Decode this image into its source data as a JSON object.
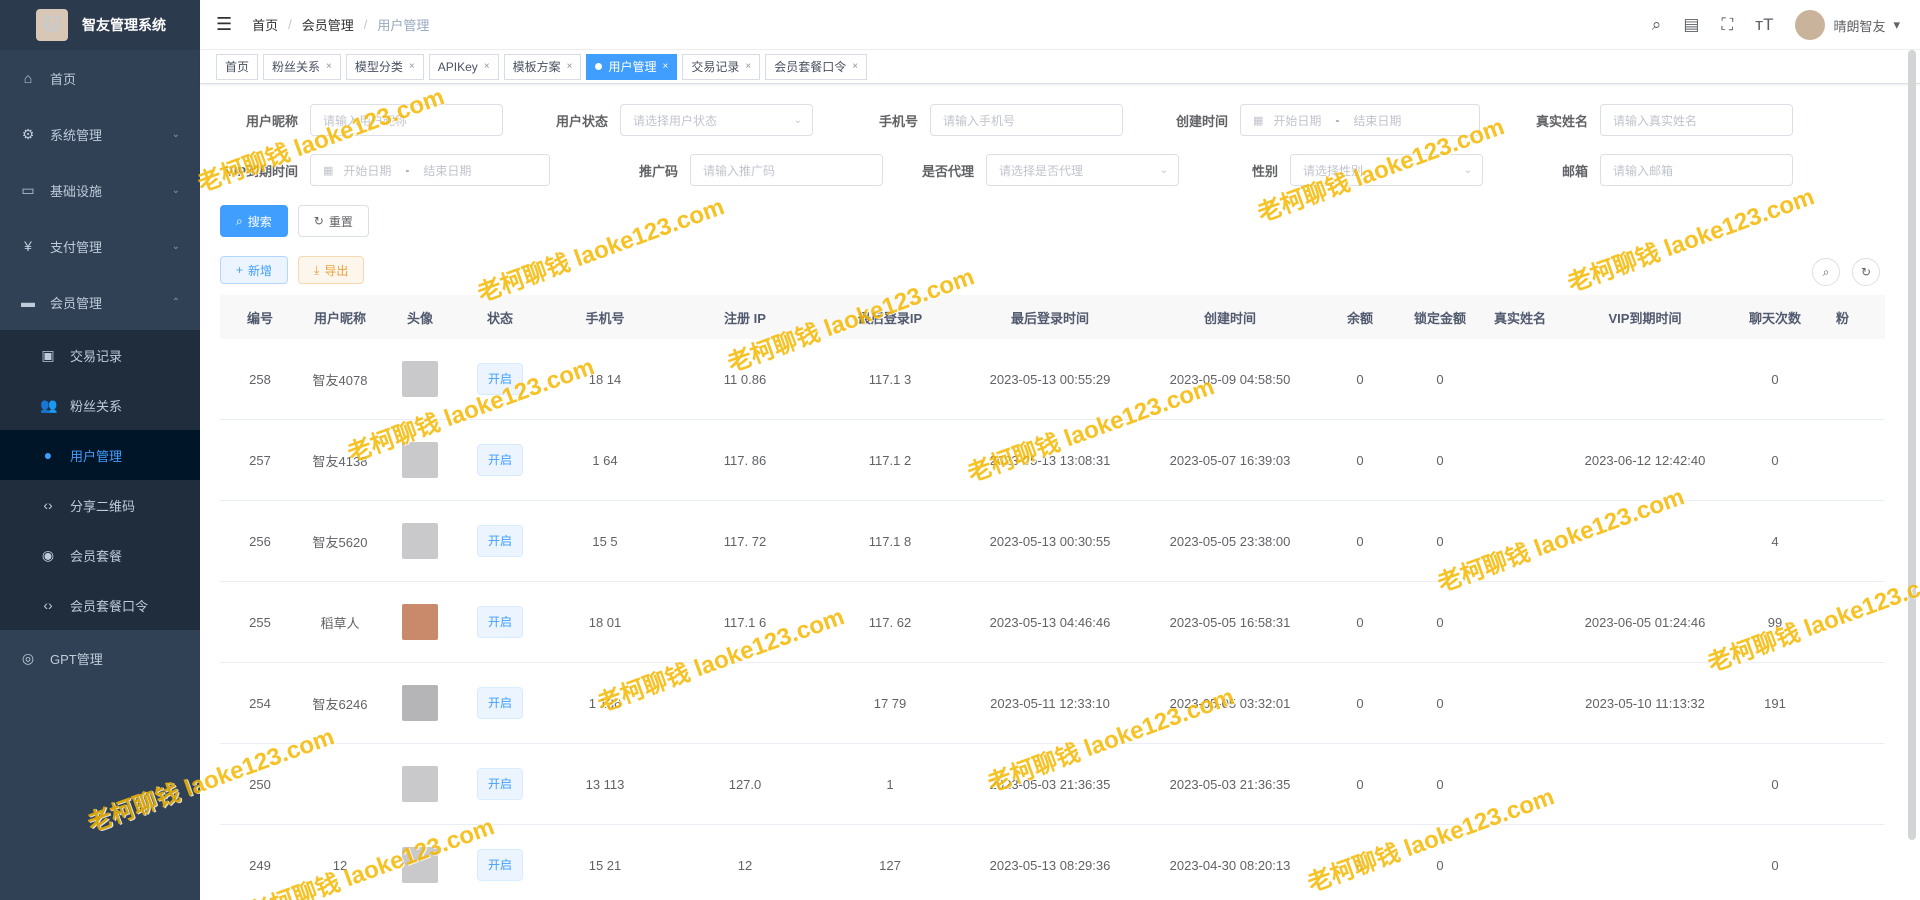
{
  "app": {
    "title": "智友管理系统"
  },
  "sidebar": {
    "items": [
      {
        "label": "首页",
        "icon": "dashboard-icon"
      },
      {
        "label": "系统管理",
        "icon": "gear-icon"
      },
      {
        "label": "基础设施",
        "icon": "monitor-icon"
      },
      {
        "label": "支付管理",
        "icon": "yen-icon"
      },
      {
        "label": "会员管理",
        "icon": "member-icon"
      }
    ],
    "subitems": [
      {
        "label": "交易记录",
        "icon": "record-icon"
      },
      {
        "label": "粉丝关系",
        "icon": "fans-icon"
      },
      {
        "label": "用户管理",
        "icon": "user-icon"
      },
      {
        "label": "分享二维码",
        "icon": "code-icon"
      },
      {
        "label": "会员套餐",
        "icon": "package-icon"
      },
      {
        "label": "会员套餐口令",
        "icon": "code-icon"
      }
    ],
    "extra": {
      "label": "GPT管理",
      "icon": "gpt-icon"
    }
  },
  "breadcrumb": [
    "首页",
    "会员管理",
    "用户管理"
  ],
  "user": {
    "name": "晴朗智友"
  },
  "tags": [
    {
      "label": "首页",
      "closable": false
    },
    {
      "label": "粉丝关系",
      "closable": true
    },
    {
      "label": "模型分类",
      "closable": true
    },
    {
      "label": "APIKey",
      "closable": true
    },
    {
      "label": "模板方案",
      "closable": true
    },
    {
      "label": "用户管理",
      "closable": true
    },
    {
      "label": "交易记录",
      "closable": true
    },
    {
      "label": "会员套餐口令",
      "closable": true
    }
  ],
  "filters": {
    "nickname": {
      "label": "用户昵称",
      "placeholder": "请输入用户昵称"
    },
    "status": {
      "label": "用户状态",
      "placeholder": "请选择用户状态"
    },
    "phone": {
      "label": "手机号",
      "placeholder": "请输入手机号"
    },
    "created": {
      "label": "创建时间",
      "start": "开始日期",
      "end": "结束日期"
    },
    "realname": {
      "label": "真实姓名",
      "placeholder": "请输入真实姓名"
    },
    "vip": {
      "label": "VIP到期时间",
      "start": "开始日期",
      "end": "结束日期"
    },
    "promo": {
      "label": "推广码",
      "placeholder": "请输入推广码"
    },
    "agent": {
      "label": "是否代理",
      "placeholder": "请选择是否代理"
    },
    "gender": {
      "label": "性别",
      "placeholder": "请选择性别"
    },
    "email": {
      "label": "邮箱",
      "placeholder": "请输入邮箱"
    }
  },
  "buttons": {
    "search": "搜索",
    "reset": "重置",
    "add": "新增",
    "export": "导出"
  },
  "table": {
    "headers": [
      "编号",
      "用户昵称",
      "头像",
      "状态",
      "手机号",
      "注册 IP",
      "最后登录IP",
      "最后登录时间",
      "创建时间",
      "余额",
      "锁定金额",
      "真实姓名",
      "VIP到期时间",
      "聊天次数",
      "粉"
    ],
    "rows": [
      {
        "id": "258",
        "nick": "智友4078",
        "avatar": "grey",
        "status": "开启",
        "phone": "18 14",
        "regip": "11 0.86",
        "lastip": "117.1 3",
        "lasttime": "2023-05-13 00:55:29",
        "created": "2023-05-09 04:58:50",
        "balance": "0",
        "frozen": "0",
        "realname": "",
        "vip": "",
        "chats": "0"
      },
      {
        "id": "257",
        "nick": "智友4138",
        "avatar": "grey",
        "status": "开启",
        "phone": "1 64",
        "regip": "117. 86",
        "lastip": "117.1 2",
        "lasttime": "2023-05-13 13:08:31",
        "created": "2023-05-07 16:39:03",
        "balance": "0",
        "frozen": "0",
        "realname": "",
        "vip": "2023-06-12 12:42:40",
        "chats": "0"
      },
      {
        "id": "256",
        "nick": "智友5620",
        "avatar": "grey",
        "status": "开启",
        "phone": "15 5",
        "regip": "117. 72",
        "lastip": "117.1 8",
        "lasttime": "2023-05-13 00:30:55",
        "created": "2023-05-05 23:38:00",
        "balance": "0",
        "frozen": "0",
        "realname": "",
        "vip": "",
        "chats": "4"
      },
      {
        "id": "255",
        "nick": "稻草人",
        "avatar": "photo",
        "status": "开启",
        "phone": "18 01",
        "regip": "117.1 6",
        "lastip": "117. 62",
        "lasttime": "2023-05-13 04:46:46",
        "created": "2023-05-05 16:58:31",
        "balance": "0",
        "frozen": "0",
        "realname": "",
        "vip": "2023-06-05 01:24:46",
        "chats": "99"
      },
      {
        "id": "254",
        "nick": "智友6246",
        "avatar": "person",
        "status": "开启",
        "phone": "1 136",
        "regip": "",
        "lastip": "17 79",
        "lasttime": "2023-05-11 12:33:10",
        "created": "2023-05-05 03:32:01",
        "balance": "0",
        "frozen": "0",
        "realname": "",
        "vip": "2023-05-10 11:13:32",
        "chats": "191"
      },
      {
        "id": "250",
        "nick": "",
        "avatar": "grey",
        "status": "开启",
        "phone": "13 113",
        "regip": "127.0",
        "lastip": "1",
        "lasttime": "2023-05-03 21:36:35",
        "created": "2023-05-03 21:36:35",
        "balance": "0",
        "frozen": "0",
        "realname": "",
        "vip": "",
        "chats": "0"
      },
      {
        "id": "249",
        "nick": "12",
        "avatar": "grey",
        "status": "开启",
        "phone": "15 21",
        "regip": "12",
        "lastip": "127",
        "lasttime": "2023-05-13 08:29:36",
        "created": "2023-04-30 08:20:13",
        "balance": "0",
        "frozen": "0",
        "realname": "",
        "vip": "",
        "chats": "0"
      }
    ]
  },
  "watermark": {
    "text": "老柯聊钱 laoke123.com",
    "color": "#f5b800"
  }
}
